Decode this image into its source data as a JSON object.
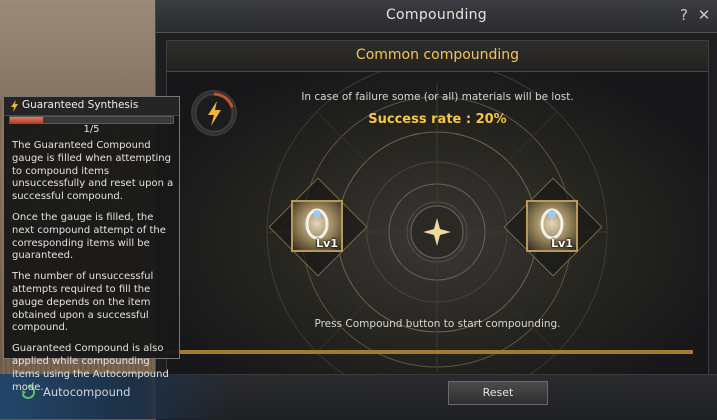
{
  "window": {
    "title": "Compounding",
    "help_glyph": "?",
    "close_glyph": "✕"
  },
  "panel": {
    "title": "Common compounding",
    "failure_note": "In case of failure some (or all) materials will be lost.",
    "success_rate": "Success rate : 20%",
    "press_note": "Press Compound button to start compounding."
  },
  "items": [
    {
      "level_label": "Lv1",
      "icon": "ring-item-icon"
    },
    {
      "level_label": "Lv1",
      "icon": "ring-item-icon"
    }
  ],
  "footer": {
    "auto_label": "Autocompound",
    "reset_label": "Reset"
  },
  "tooltip": {
    "title": "Guaranteed Synthesis",
    "progress_text": "1/5",
    "progress_fraction": 0.2,
    "paragraphs": [
      "The Guaranteed Compound gauge is filled when attempting to compound items unsuccessfully and reset upon a successful compound.",
      "Once the gauge is filled, the next compound attempt of the corresponding items will be guaranteed.",
      "The number of unsuccessful attempts required to fill the gauge depends on the item obtained upon a successful compound.",
      "Guaranteed Compound is also applied while compounding items using the Autocompound mode."
    ]
  },
  "colors": {
    "accent_gold": "#f2c55a",
    "success_yellow": "#f5c743",
    "gauge_red": "#c8502f",
    "auto_blue": "#22466a"
  }
}
